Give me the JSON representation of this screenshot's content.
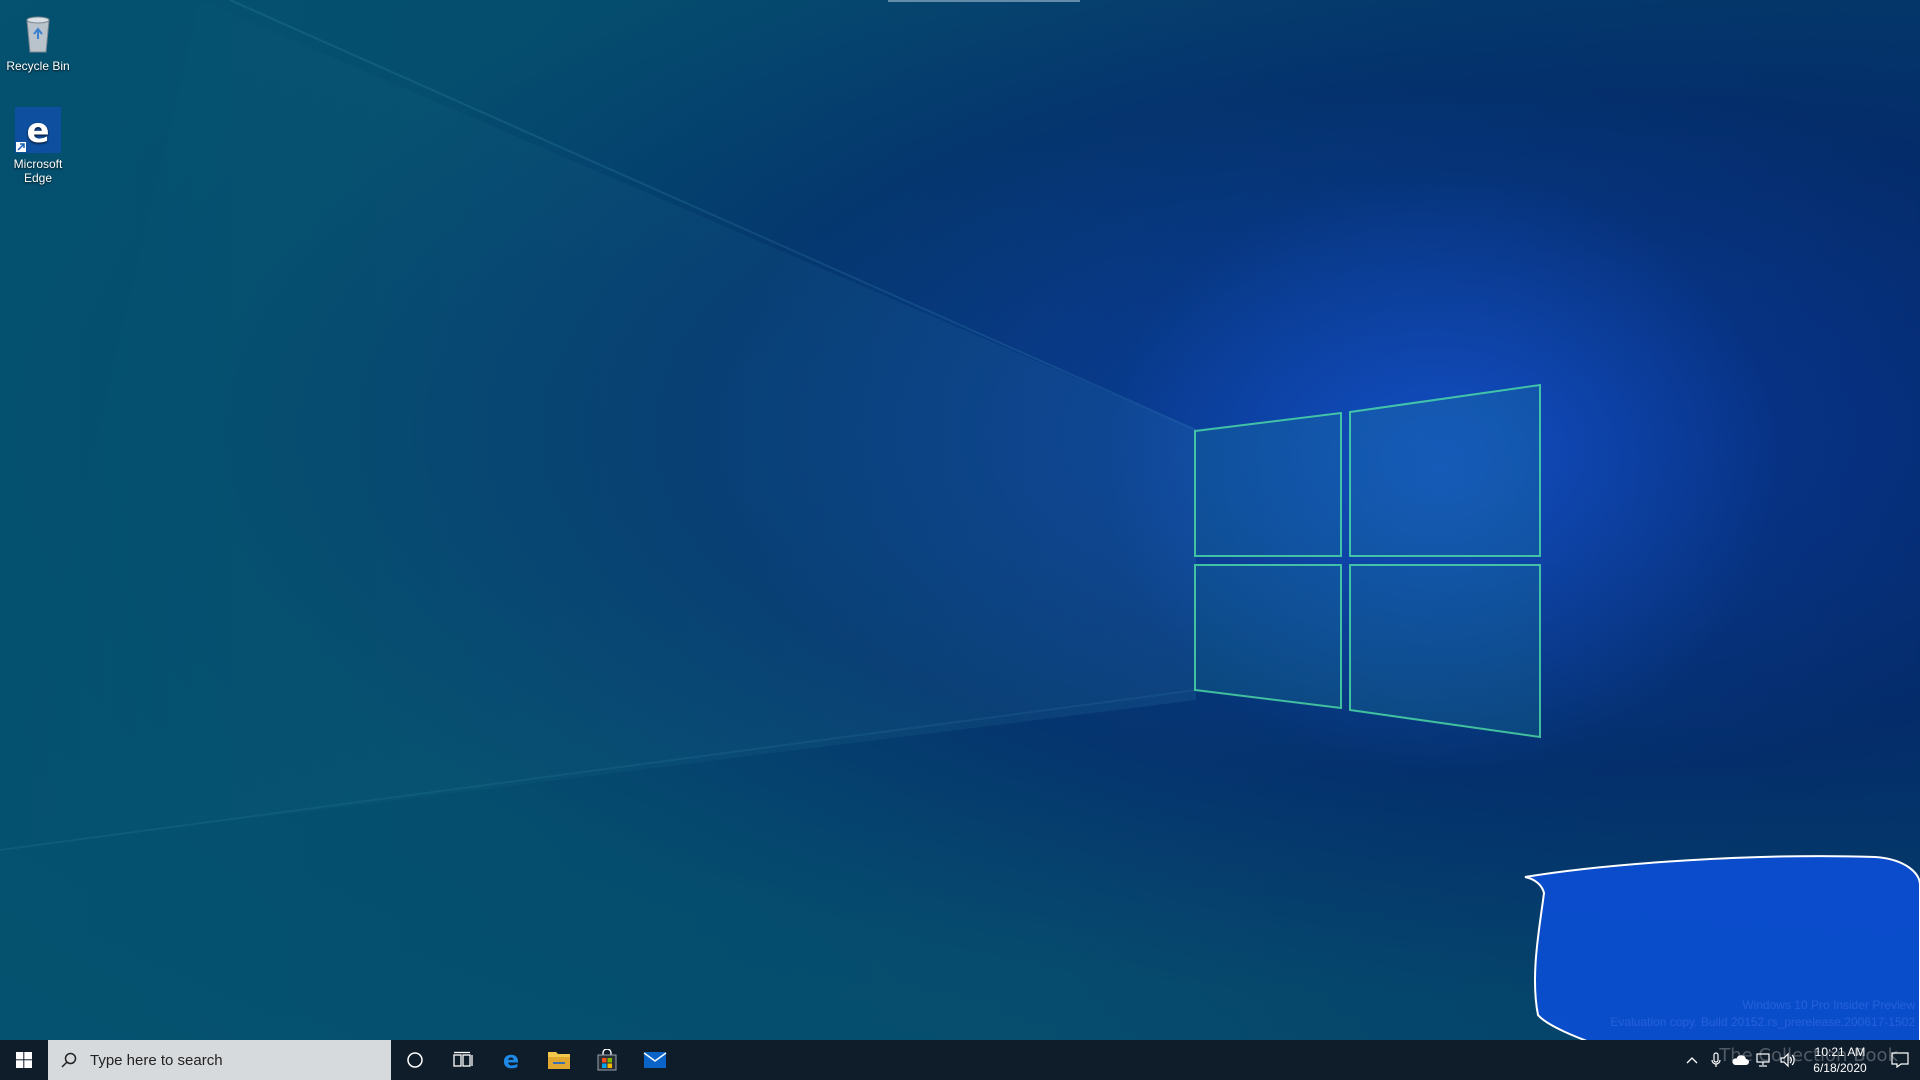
{
  "desktop": {
    "icons": [
      {
        "label": "Recycle Bin",
        "icon": "recycle-bin-icon"
      },
      {
        "label": "Microsoft Edge",
        "icon": "edge-icon"
      }
    ],
    "wallpaper_logo": "windows-logo"
  },
  "watermark": {
    "line1": "Windows 10 Pro Insider Preview",
    "line2": "Evaluation copy. Build 20152.rs_prerelease.200617-1502"
  },
  "taskbar": {
    "search_placeholder": "Type here to search",
    "pinned": [
      "cortana-icon",
      "task-view-icon",
      "edge-icon",
      "file-explorer-icon",
      "store-icon",
      "mail-icon"
    ],
    "tray": {
      "icons": [
        "show-hidden-icons-chevron",
        "microphone-icon",
        "onedrive-icon",
        "network-icon",
        "volume-icon"
      ],
      "time": "10:21 AM",
      "date": "6/18/2020"
    }
  },
  "overlay_brand": "The Collection Book",
  "colors": {
    "taskbar": "#0f1c2a",
    "search_box": "#d7dadd",
    "highlight_blob": "#0b4fd6",
    "logo_edge": "#4fe0a8"
  }
}
